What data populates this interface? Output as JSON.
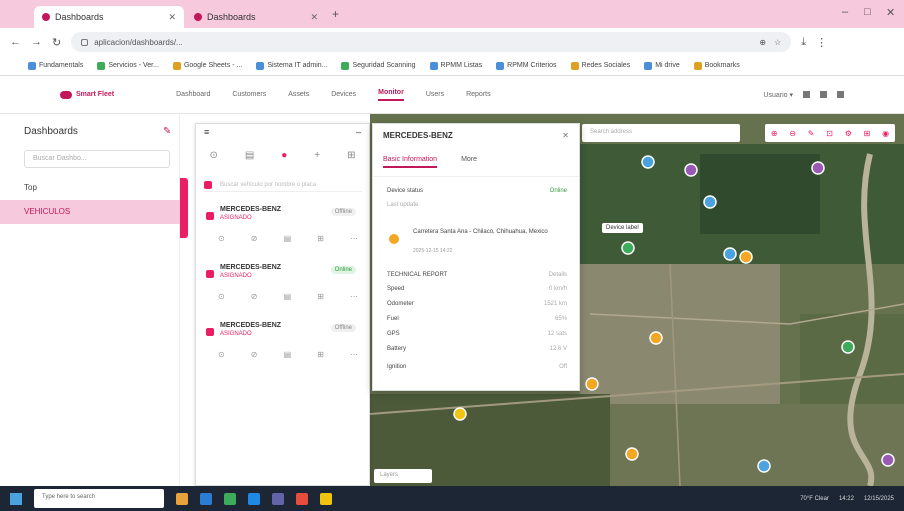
{
  "browser": {
    "tabs": [
      {
        "label": "Dashboards"
      },
      {
        "label": "Dashboards"
      }
    ],
    "new_tab": "+",
    "window_controls": [
      "–",
      "□",
      "✕"
    ],
    "url": "aplicacion/dashboards/..."
  },
  "bookmarks": [
    "Fundamentals",
    "Servicios - Ver...",
    "Google Sheets - ...",
    "Sistema IT admin...",
    "Seguridad Scanning",
    "RPMM Listas",
    "RPMM Criterios",
    "Redes Sociales",
    "Mi drive",
    "Bookmarks"
  ],
  "app_nav": {
    "logo": "Smart Fleet",
    "items": [
      "Dashboard",
      "Customers",
      "Assets",
      "Devices",
      "Monitor",
      "Users",
      "Reports"
    ],
    "active": "Monitor",
    "user": "Usuario ▾"
  },
  "sidebar": {
    "title": "Dashboards",
    "search_placeholder": "Buscar Dashbo...",
    "items": [
      "Top",
      "VEHICULOS"
    ]
  },
  "vehicle_panel": {
    "title": "≡",
    "collapse": "–",
    "tools": [
      "⊙",
      "▤",
      "●",
      "+",
      "⊞"
    ],
    "search_placeholder": "Buscar vehículo por nombre o placa",
    "vehicles": [
      {
        "name": "MERCEDES-BENZ",
        "sub": "ASIGNADO",
        "status": "Offline",
        "online": false
      },
      {
        "name": "MERCEDES-BENZ",
        "sub": "ASIGNADO",
        "status": "Online",
        "online": true
      },
      {
        "name": "MERCEDES-BENZ",
        "sub": "ASIGNADO",
        "status": "Offline",
        "online": false
      }
    ],
    "row_actions": [
      "⊙",
      "⊘",
      "▤",
      "⊞",
      "⋯"
    ]
  },
  "detail": {
    "title": "MERCEDES-BENZ",
    "close": "✕",
    "tabs": [
      "Basic Information",
      "More"
    ],
    "active_tab": "Basic Information",
    "status_label": "Device status",
    "status_value": "Online",
    "last_update": "Last update",
    "address": "Carretera Santa Ana - Chilaco, Chihuahua, Mexico",
    "timestamp": "2025-12-15 14:22",
    "section": "TECHNICAL REPORT",
    "section_value": "Details",
    "rows": [
      {
        "k": "Speed",
        "v": "0 km/h"
      },
      {
        "k": "Odometer",
        "v": "1521 km"
      },
      {
        "k": "Fuel",
        "v": "65%"
      },
      {
        "k": "GPS",
        "v": "12 sats"
      },
      {
        "k": "Battery",
        "v": "12.6 V"
      },
      {
        "k": "Ignition",
        "v": "Off"
      }
    ]
  },
  "map": {
    "search_placeholder": "Search address",
    "tools": [
      "⊕",
      "⊖",
      "✎",
      "⊡",
      "⚙",
      "⊞",
      "◉"
    ],
    "label": "Device label",
    "bottom_button": "Layers"
  },
  "taskbar": {
    "search": "Type here to search",
    "time": "14:22",
    "date": "12/15/2025",
    "weather": "70°F Clear"
  }
}
